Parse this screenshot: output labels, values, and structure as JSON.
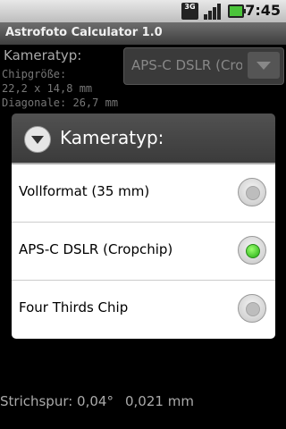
{
  "status_bar": {
    "network": "3G",
    "time": "7:45"
  },
  "app": {
    "title": "Astrofoto Calculator  1.0"
  },
  "background": {
    "camera_label": "Kameratyp:",
    "chip_size_label": "Chipgröße:",
    "chip_size_value": "22,2 x 14,8 mm",
    "diagonal": "Diagonale: 26,7 mm",
    "spinner_value": "APS-C DSLR (Cropchip)",
    "strip_label": "Strichspur: 0,04°",
    "strip_value": "0,021 mm"
  },
  "dialog": {
    "title": "Kameratyp:",
    "options": [
      {
        "label": "Vollformat (35 mm)",
        "selected": false
      },
      {
        "label": "APS-C DSLR (Cropchip)",
        "selected": true
      },
      {
        "label": "Four Thirds Chip",
        "selected": false
      }
    ]
  }
}
